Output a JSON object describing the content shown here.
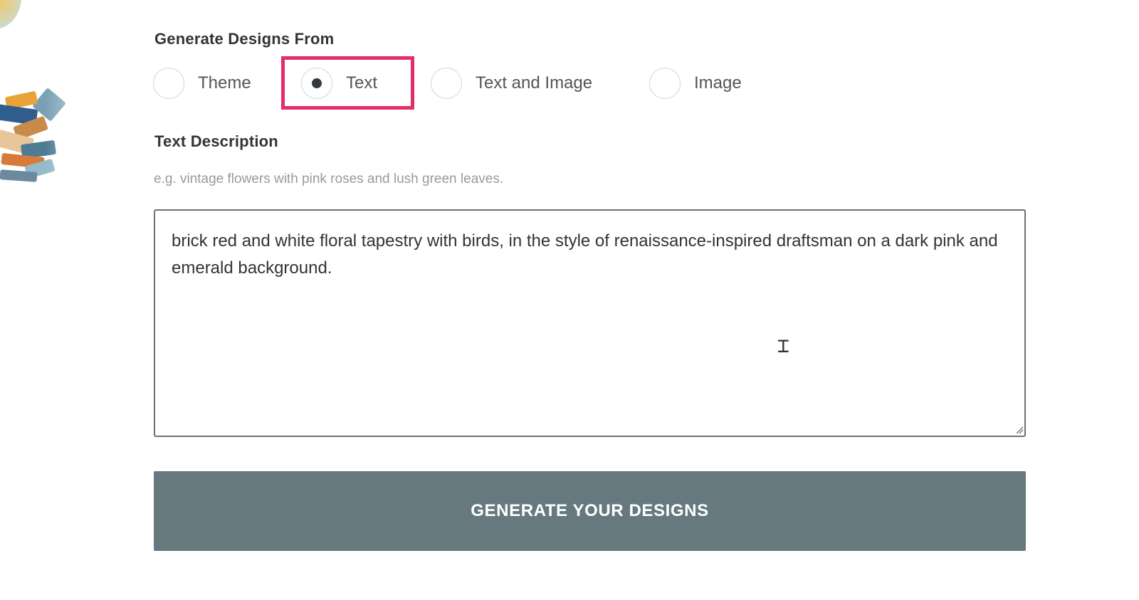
{
  "form": {
    "generate_from_label": "Generate Designs From",
    "options": [
      {
        "label": "Theme",
        "selected": false
      },
      {
        "label": "Text",
        "selected": true
      },
      {
        "label": "Text and Image",
        "selected": false
      },
      {
        "label": "Image",
        "selected": false
      }
    ],
    "text_description_label": "Text Description",
    "hint": "e.g. vintage flowers with pink roses and lush green leaves.",
    "textarea_value": "brick red and white floral tapestry with birds, in the style of renaissance-inspired draftsman on a dark pink and emerald background.",
    "submit_label": "GENERATE YOUR DESIGNS"
  },
  "colors": {
    "highlight": "#e52d66",
    "button_bg": "#65797e",
    "radio_dot": "#333a3f"
  },
  "icons": {
    "cursor": "i-beam-cursor-icon",
    "radio_selected": "radio-dot-icon",
    "resize": "resize-grip-icon"
  }
}
